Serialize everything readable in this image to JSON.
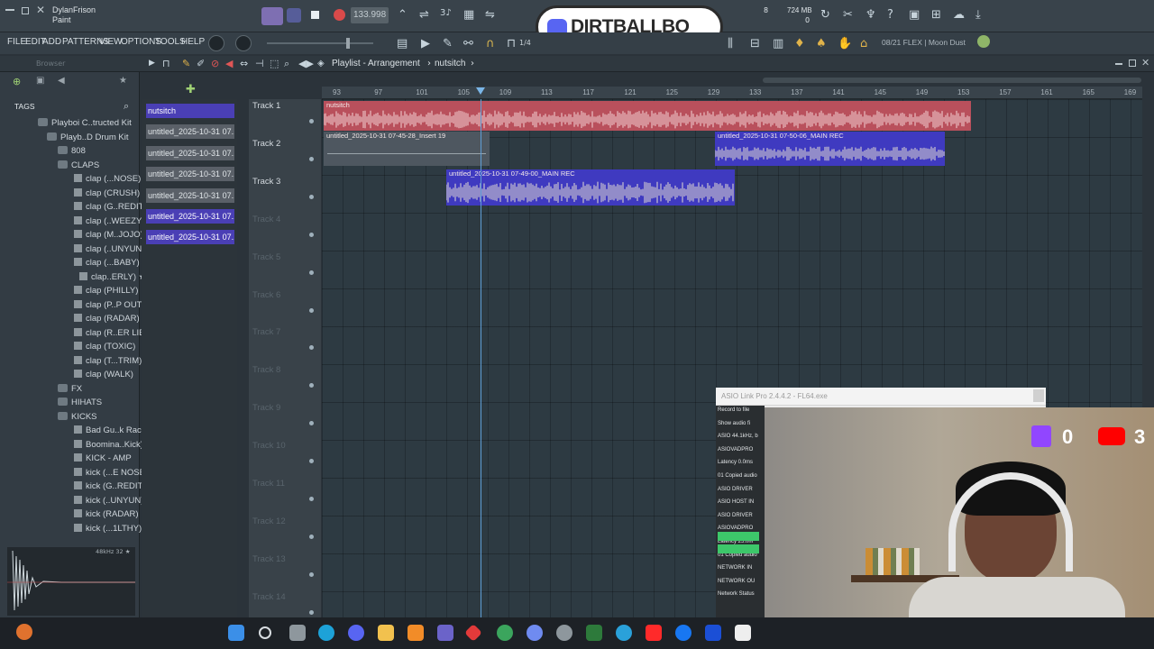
{
  "window": {
    "user": "DylanFrison",
    "tool_name": "Paint",
    "tempo": "133.998",
    "cpu_value": "8",
    "memory": "724 MB",
    "memory_sub": "0",
    "snap": "1/4",
    "hint_text": "08/21 FLEX | Moon Dust"
  },
  "brand_banner": "DIRTBALLBO",
  "menu": [
    "FILE",
    "EDIT",
    "ADD",
    "PATTERNS",
    "VIEW",
    "OPTIONS",
    "TOOLS",
    "HELP"
  ],
  "browser": {
    "title": "Browser",
    "tags_label": "TAGS",
    "items": [
      {
        "label": "Playboi C..tructed Kit",
        "kind": "folder"
      },
      {
        "label": "Playb..D Drum Kit",
        "kind": "folder"
      },
      {
        "label": "808",
        "kind": "folder"
      },
      {
        "label": "CLAPS",
        "kind": "folder"
      },
      {
        "label": "clap (...NOSE)",
        "kind": "file"
      },
      {
        "label": "clap (CRUSH)",
        "kind": "file"
      },
      {
        "label": "clap (G..REDIT)",
        "kind": "file"
      },
      {
        "label": "clap (..WEEZY)",
        "kind": "file"
      },
      {
        "label": "clap (M..JOJO)",
        "kind": "file"
      },
      {
        "label": "clap (..UNYUN)",
        "kind": "file"
      },
      {
        "label": "clap (...BABY)",
        "kind": "file"
      },
      {
        "label": "clap..ERLY) ★",
        "kind": "file"
      },
      {
        "label": "clap (PHILLY)",
        "kind": "file"
      },
      {
        "label": "clap (P..P OUT)",
        "kind": "file"
      },
      {
        "label": "clap (RADAR)",
        "kind": "file"
      },
      {
        "label": "clap (R..ER LIE)",
        "kind": "file"
      },
      {
        "label": "clap (TOXIC)",
        "kind": "file"
      },
      {
        "label": "clap (T...TRIM)",
        "kind": "file"
      },
      {
        "label": "clap (WALK)",
        "kind": "file"
      },
      {
        "label": "FX",
        "kind": "folder"
      },
      {
        "label": "HIHATS",
        "kind": "folder"
      },
      {
        "label": "KICKS",
        "kind": "folder"
      },
      {
        "label": "Bad Gu..k Rack",
        "kind": "file"
      },
      {
        "label": "Boomina..Kick)",
        "kind": "file"
      },
      {
        "label": "KICK - AMP",
        "kind": "file"
      },
      {
        "label": "kick (...E NOSE)",
        "kind": "file"
      },
      {
        "label": "kick (G..REDIT)",
        "kind": "file"
      },
      {
        "label": "kick (..UNYUN)",
        "kind": "file"
      },
      {
        "label": "kick (RADAR)",
        "kind": "file"
      },
      {
        "label": "kick (...1LTHY)",
        "kind": "file"
      }
    ],
    "sample_info": "48kHz 32 ★"
  },
  "playlist": {
    "breadcrumb_prefix": "Playlist - Arrangement",
    "breadcrumb_pattern": "nutsitch",
    "picker": [
      {
        "label": "nutsitch",
        "selected": false,
        "head": true
      },
      {
        "label": "untitled_2025-10-31 07...",
        "selected": false
      },
      {
        "label": "untitled_2025-10-31 07...",
        "selected": false
      },
      {
        "label": "untitled_2025-10-31 07...",
        "selected": false
      },
      {
        "label": "untitled_2025-10-31 07...",
        "selected": false
      },
      {
        "label": "untitled_2025-10-31 07...",
        "selected": true
      },
      {
        "label": "untitled_2025-10-31 07...",
        "selected": true
      }
    ],
    "ruler": [
      "93",
      "97",
      "101",
      "105",
      "109",
      "113",
      "117",
      "121",
      "125",
      "129",
      "133",
      "137",
      "141",
      "145",
      "149",
      "153",
      "157",
      "161",
      "165",
      "169"
    ],
    "tracks": [
      "Track 1",
      "Track 2",
      "Track 3",
      "Track 4",
      "Track 5",
      "Track 6",
      "Track 7",
      "Track 8",
      "Track 9",
      "Track 10",
      "Track 11",
      "Track 12",
      "Track 13",
      "Track 14"
    ],
    "clips": [
      {
        "title": "nutsitch",
        "color": "#d86a73"
      },
      {
        "title": "untitled_2025-10-31 07-45-28_Insert 19",
        "color": "#596068"
      },
      {
        "title": "untitled_2025-10-31 07-50-06_MAIN REC",
        "color": "#6a5fd0"
      },
      {
        "title": "untitled_2025-10-31 07-49-00_MAIN REC",
        "color": "#6a5fd0"
      }
    ]
  },
  "asio_panel": {
    "title": "ASIO Link Pro 2.4.4.2 - FL64.exe",
    "lines": [
      "Record to file",
      "Show audio fi",
      "ASIO 44.1kHz, b",
      "ASIOVADPRO",
      "Latency 0.0ms",
      "01 Copied audio",
      "ASIO DRIVER",
      "ASIO HOST IN",
      "ASIO DRIVER",
      "ASIOVADPRO",
      "Latency 25.0m",
      "01 Copied audio",
      "NETWORK IN",
      "NETWORK OU",
      "Network Status"
    ]
  },
  "stream_overlay": {
    "twitch_count": "0",
    "youtube_count": "3"
  }
}
